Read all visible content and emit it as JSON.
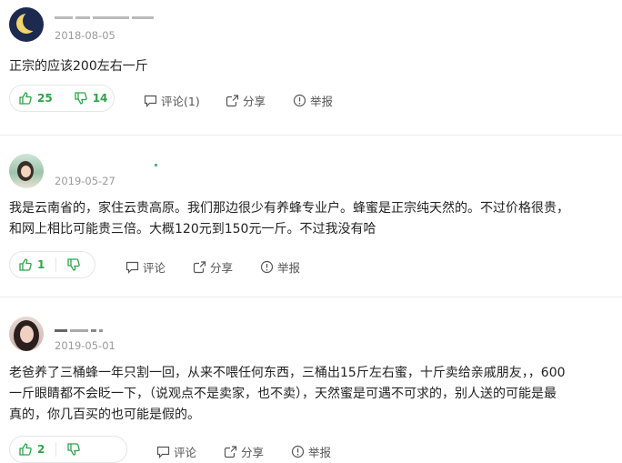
{
  "answers": [
    {
      "date": "2018-08-05",
      "content": [
        "正宗的应该200左右一斤"
      ],
      "likes": "25",
      "dislikes": "14",
      "comment_label": "评论(1)",
      "share_label": "分享",
      "report_label": "举报"
    },
    {
      "date": "2019-05-27",
      "content": [
        "我是云南省的，家住云贵高原。我们那边很少有养蜂专业户。蜂蜜是正宗纯天然的。不过价格很贵，",
        "和网上相比可能贵三倍。大概120元到150元一斤。不过我没有哈"
      ],
      "likes": "1",
      "dislikes": "",
      "comment_label": "评论",
      "share_label": "分享",
      "report_label": "举报"
    },
    {
      "date": "2019-05-01",
      "content": [
        "老爸养了三桶蜂一年只割一回，从来不喂任何东西，三桶出15斤左右蜜，十斤卖给亲戚朋友，，600",
        "一斤眼睛都不会眨一下，（说观点不是卖家，也不卖），天然蜜是可遇不可求的，别人送的可能是最",
        "真的，你几百买的也可能是假的。"
      ],
      "likes": "2",
      "dislikes": "",
      "comment_label": "评论",
      "share_label": "分享",
      "report_label": "举报"
    }
  ],
  "colors": {
    "vote_green": "#2fa34a",
    "date_gray": "#9a9a9a",
    "action_gray": "#555555"
  },
  "icons": [
    "moon-avatar",
    "thumbs-up-icon",
    "thumbs-down-icon",
    "comment-icon",
    "share-icon",
    "report-icon"
  ]
}
